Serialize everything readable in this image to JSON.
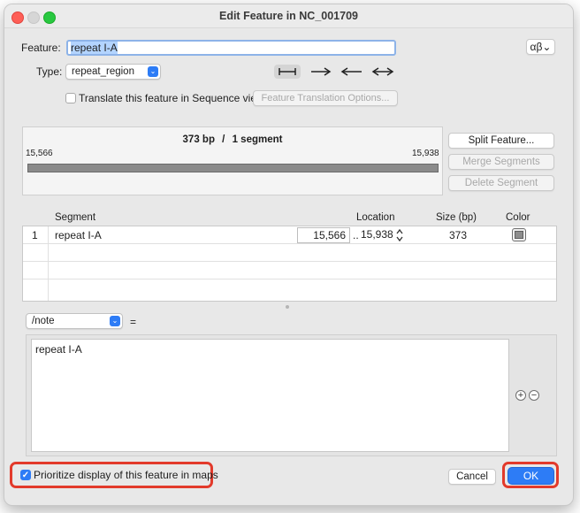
{
  "window": {
    "title": "Edit Feature in NC_001709"
  },
  "feature": {
    "label": "Feature:",
    "name_value": "repeat I-A"
  },
  "charset_button": {
    "label": "αβ⌄"
  },
  "type": {
    "label": "Type:",
    "value": "repeat_region"
  },
  "direction_icons": {
    "none": "⟝⟞",
    "forward": "⟶",
    "reverse": "⟵",
    "both": "⟷"
  },
  "translate": {
    "checkbox_label": "Translate this feature in Sequence view",
    "checked": false,
    "options_button": "Feature Translation Options..."
  },
  "map": {
    "summary_bp": "373 bp",
    "separator": "/",
    "summary_segments": "1 segment",
    "start_label": "15,566",
    "end_label": "15,938"
  },
  "segment_buttons": {
    "split": "Split Feature...",
    "merge": "Merge Segments",
    "delete": "Delete Segment"
  },
  "table": {
    "headers": {
      "segment": "Segment",
      "location": "Location",
      "size": "Size (bp)",
      "color": "Color"
    },
    "rows": [
      {
        "index": "1",
        "name": "repeat I-A",
        "start": "15,566",
        "dots": "..",
        "end": "15,938",
        "size": "373",
        "color": "#8c8c8c"
      }
    ]
  },
  "qualifier": {
    "name": "/note",
    "equals": "=",
    "value": "repeat I-A"
  },
  "qualifier_buttons": {
    "add": "+",
    "remove": "−"
  },
  "prioritize": {
    "label": "Prioritize display of this feature in maps",
    "checked": true
  },
  "footer": {
    "cancel": "Cancel",
    "ok": "OK"
  },
  "colors": {
    "accent": "#2d7cf6",
    "highlight": "#e23a2b"
  }
}
